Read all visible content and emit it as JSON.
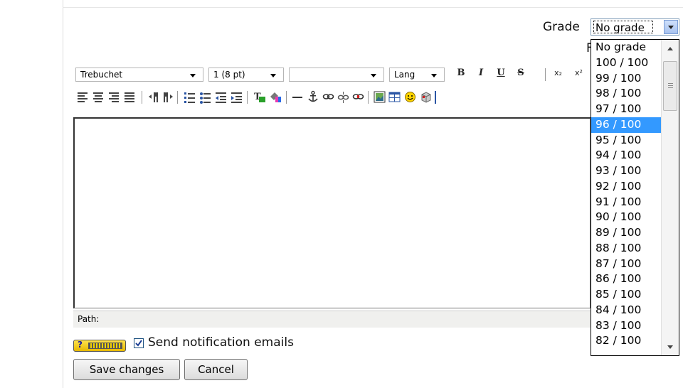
{
  "grade": {
    "label": "Grade",
    "selected": "No grade",
    "options": [
      "No grade",
      "100 / 100",
      "99 / 100",
      "98 / 100",
      "97 / 100",
      "96 / 100",
      "95 / 100",
      "94 / 100",
      "93 / 100",
      "92 / 100",
      "91 / 100",
      "90 / 100",
      "89 / 100",
      "88 / 100",
      "87 / 100",
      "86 / 100",
      "85 / 100",
      "84 / 100",
      "83 / 100",
      "82 / 100"
    ],
    "highlighted": "96 / 100"
  },
  "partial_label": "F",
  "toolbar": {
    "font_family": "Trebuchet",
    "font_size": "1 (8 pt)",
    "format": "",
    "language": "Lang",
    "bold": "B",
    "italic": "I",
    "underline": "U",
    "strikethrough": "S",
    "subscript": "x₂",
    "superscript": "x²"
  },
  "editor": {
    "content": "",
    "path_label": "Path:"
  },
  "help_button_text": "?",
  "notification": {
    "checked": true,
    "label": "Send notification emails"
  },
  "buttons": {
    "save": "Save changes",
    "cancel": "Cancel"
  }
}
